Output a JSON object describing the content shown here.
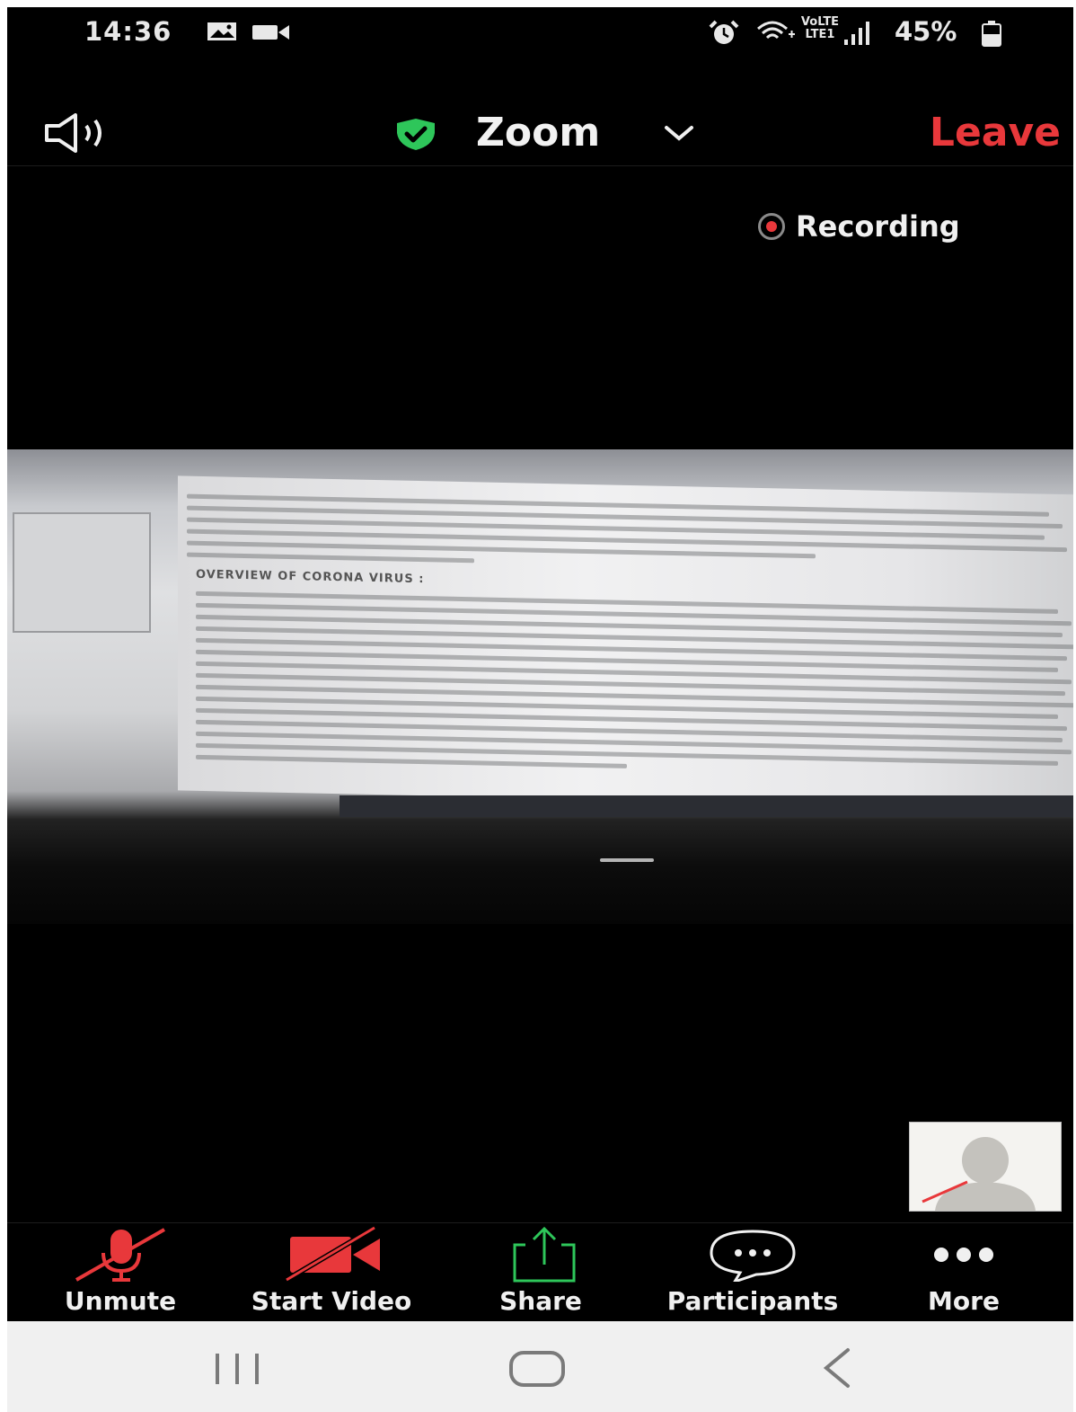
{
  "status_bar": {
    "time": "14:36",
    "network": "VoLTE LTE1",
    "battery": "45%",
    "icons": [
      "gallery-icon",
      "video-icon",
      "alarm-icon",
      "wifi-icon",
      "signal-icon",
      "battery-icon"
    ]
  },
  "header": {
    "title": "Zoom",
    "leave_label": "Leave",
    "leave_color": "#e8383b",
    "shield_color": "#2ec65a"
  },
  "recording": {
    "label": "Recording"
  },
  "shared_content": {
    "heading": "OVERVIEW OF CORONA VIRUS :"
  },
  "toolbar": {
    "unmute_label": "Unmute",
    "start_video_label": "Start Video",
    "share_label": "Share",
    "participants_label": "Participants",
    "more_label": "More"
  },
  "nav": {
    "icons": [
      "recent-apps-icon",
      "home-icon",
      "back-icon"
    ]
  }
}
